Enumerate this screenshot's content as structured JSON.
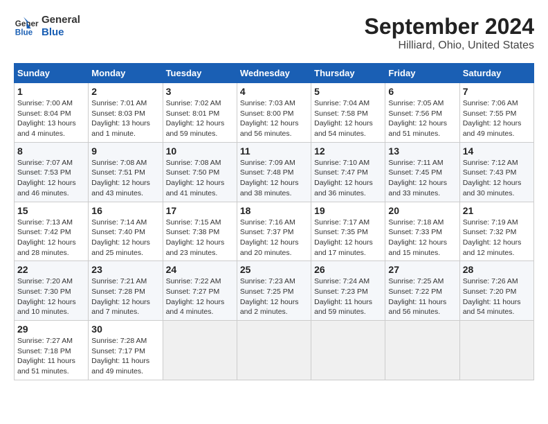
{
  "logo": {
    "line1": "General",
    "line2": "Blue"
  },
  "title": "September 2024",
  "subtitle": "Hilliard, Ohio, United States",
  "days_of_week": [
    "Sunday",
    "Monday",
    "Tuesday",
    "Wednesday",
    "Thursday",
    "Friday",
    "Saturday"
  ],
  "weeks": [
    [
      {
        "num": "1",
        "sunrise": "7:00 AM",
        "sunset": "8:04 PM",
        "daylight": "13 hours and 4 minutes."
      },
      {
        "num": "2",
        "sunrise": "7:01 AM",
        "sunset": "8:03 PM",
        "daylight": "13 hours and 1 minute."
      },
      {
        "num": "3",
        "sunrise": "7:02 AM",
        "sunset": "8:01 PM",
        "daylight": "12 hours and 59 minutes."
      },
      {
        "num": "4",
        "sunrise": "7:03 AM",
        "sunset": "8:00 PM",
        "daylight": "12 hours and 56 minutes."
      },
      {
        "num": "5",
        "sunrise": "7:04 AM",
        "sunset": "7:58 PM",
        "daylight": "12 hours and 54 minutes."
      },
      {
        "num": "6",
        "sunrise": "7:05 AM",
        "sunset": "7:56 PM",
        "daylight": "12 hours and 51 minutes."
      },
      {
        "num": "7",
        "sunrise": "7:06 AM",
        "sunset": "7:55 PM",
        "daylight": "12 hours and 49 minutes."
      }
    ],
    [
      {
        "num": "8",
        "sunrise": "7:07 AM",
        "sunset": "7:53 PM",
        "daylight": "12 hours and 46 minutes."
      },
      {
        "num": "9",
        "sunrise": "7:08 AM",
        "sunset": "7:51 PM",
        "daylight": "12 hours and 43 minutes."
      },
      {
        "num": "10",
        "sunrise": "7:08 AM",
        "sunset": "7:50 PM",
        "daylight": "12 hours and 41 minutes."
      },
      {
        "num": "11",
        "sunrise": "7:09 AM",
        "sunset": "7:48 PM",
        "daylight": "12 hours and 38 minutes."
      },
      {
        "num": "12",
        "sunrise": "7:10 AM",
        "sunset": "7:47 PM",
        "daylight": "12 hours and 36 minutes."
      },
      {
        "num": "13",
        "sunrise": "7:11 AM",
        "sunset": "7:45 PM",
        "daylight": "12 hours and 33 minutes."
      },
      {
        "num": "14",
        "sunrise": "7:12 AM",
        "sunset": "7:43 PM",
        "daylight": "12 hours and 30 minutes."
      }
    ],
    [
      {
        "num": "15",
        "sunrise": "7:13 AM",
        "sunset": "7:42 PM",
        "daylight": "12 hours and 28 minutes."
      },
      {
        "num": "16",
        "sunrise": "7:14 AM",
        "sunset": "7:40 PM",
        "daylight": "12 hours and 25 minutes."
      },
      {
        "num": "17",
        "sunrise": "7:15 AM",
        "sunset": "7:38 PM",
        "daylight": "12 hours and 23 minutes."
      },
      {
        "num": "18",
        "sunrise": "7:16 AM",
        "sunset": "7:37 PM",
        "daylight": "12 hours and 20 minutes."
      },
      {
        "num": "19",
        "sunrise": "7:17 AM",
        "sunset": "7:35 PM",
        "daylight": "12 hours and 17 minutes."
      },
      {
        "num": "20",
        "sunrise": "7:18 AM",
        "sunset": "7:33 PM",
        "daylight": "12 hours and 15 minutes."
      },
      {
        "num": "21",
        "sunrise": "7:19 AM",
        "sunset": "7:32 PM",
        "daylight": "12 hours and 12 minutes."
      }
    ],
    [
      {
        "num": "22",
        "sunrise": "7:20 AM",
        "sunset": "7:30 PM",
        "daylight": "12 hours and 10 minutes."
      },
      {
        "num": "23",
        "sunrise": "7:21 AM",
        "sunset": "7:28 PM",
        "daylight": "12 hours and 7 minutes."
      },
      {
        "num": "24",
        "sunrise": "7:22 AM",
        "sunset": "7:27 PM",
        "daylight": "12 hours and 4 minutes."
      },
      {
        "num": "25",
        "sunrise": "7:23 AM",
        "sunset": "7:25 PM",
        "daylight": "12 hours and 2 minutes."
      },
      {
        "num": "26",
        "sunrise": "7:24 AM",
        "sunset": "7:23 PM",
        "daylight": "11 hours and 59 minutes."
      },
      {
        "num": "27",
        "sunrise": "7:25 AM",
        "sunset": "7:22 PM",
        "daylight": "11 hours and 56 minutes."
      },
      {
        "num": "28",
        "sunrise": "7:26 AM",
        "sunset": "7:20 PM",
        "daylight": "11 hours and 54 minutes."
      }
    ],
    [
      {
        "num": "29",
        "sunrise": "7:27 AM",
        "sunset": "7:18 PM",
        "daylight": "11 hours and 51 minutes."
      },
      {
        "num": "30",
        "sunrise": "7:28 AM",
        "sunset": "7:17 PM",
        "daylight": "11 hours and 49 minutes."
      },
      null,
      null,
      null,
      null,
      null
    ]
  ]
}
